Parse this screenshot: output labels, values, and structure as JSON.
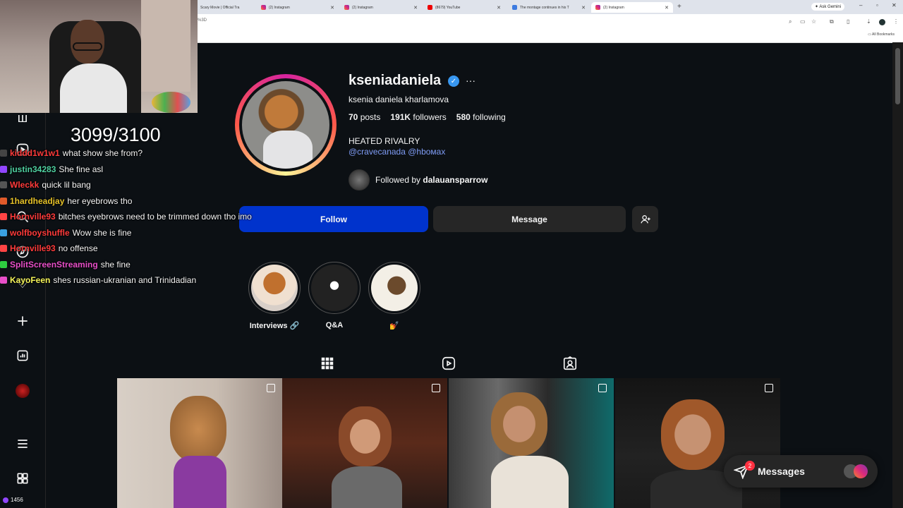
{
  "browser": {
    "tabs": [
      {
        "title": "Scary Movie | Official Tra",
        "icon": "doc",
        "left": 0
      },
      {
        "title": "(2) Instagram",
        "icon": "ig"
      },
      {
        "title": "(2) Instagram",
        "icon": "ig"
      },
      {
        "title": "(8679) YouTube",
        "icon": "yt"
      },
      {
        "title": "The montage continues in his T",
        "icon": "doc"
      },
      {
        "title": "(2) Instagram",
        "icon": "ig"
      }
    ],
    "url_fragment": "%3D",
    "ask_gemini": "Ask Gemini",
    "all_bookmarks": "All Bookmarks"
  },
  "stream": {
    "counter": "3099/3100",
    "viewer_count": "1456",
    "chat": [
      {
        "user": "kiddd1w1w1",
        "user_color": "#ff3b3b",
        "message": "what show she from?"
      },
      {
        "user": "justin34283",
        "user_color": "#4fd1a1",
        "message": "She fine asl"
      },
      {
        "user": "Wleckk",
        "user_color": "#ff3b3b",
        "message": "quick lil bang"
      },
      {
        "user": "1hardheadjay",
        "user_color": "#e6c229",
        "message": "her eyebrows tho"
      },
      {
        "user": "Hornville93",
        "user_color": "#ff3b3b",
        "message": "bitches eyebrows need to be trimmed down tho imo"
      },
      {
        "user": "wolfboyshuffle",
        "user_color": "#ff3b3b",
        "message": "Wow she is fine"
      },
      {
        "user": "Hornville93",
        "user_color": "#ff3b3b",
        "message": "no offense"
      },
      {
        "user": "SplitScreenStreaming",
        "user_color": "#e84fc9",
        "message": "she fine"
      },
      {
        "user": "KayoFeen",
        "user_color": "#f5f55a",
        "message": "shes russian-ukranian and Trinidadian"
      }
    ]
  },
  "profile": {
    "username": "kseniadaniela",
    "full_name": "ksenia daniela kharlamova",
    "posts_count": "70",
    "posts_label": "posts",
    "followers_count": "191K",
    "followers_label": "followers",
    "following_count": "580",
    "following_label": "following",
    "bio": "HEATED RIVALRY",
    "bio_links": "@cravecanada @hboмax",
    "followed_by_prefix": "Followed by",
    "followed_by_user": "dalauansparrow",
    "follow_label": "Follow",
    "message_label": "Message"
  },
  "highlights": [
    {
      "label": "Interviews 🔗"
    },
    {
      "label": "Q&A"
    },
    {
      "label": "💅"
    }
  ],
  "messages_pill": {
    "label": "Messages",
    "unread": "2"
  }
}
